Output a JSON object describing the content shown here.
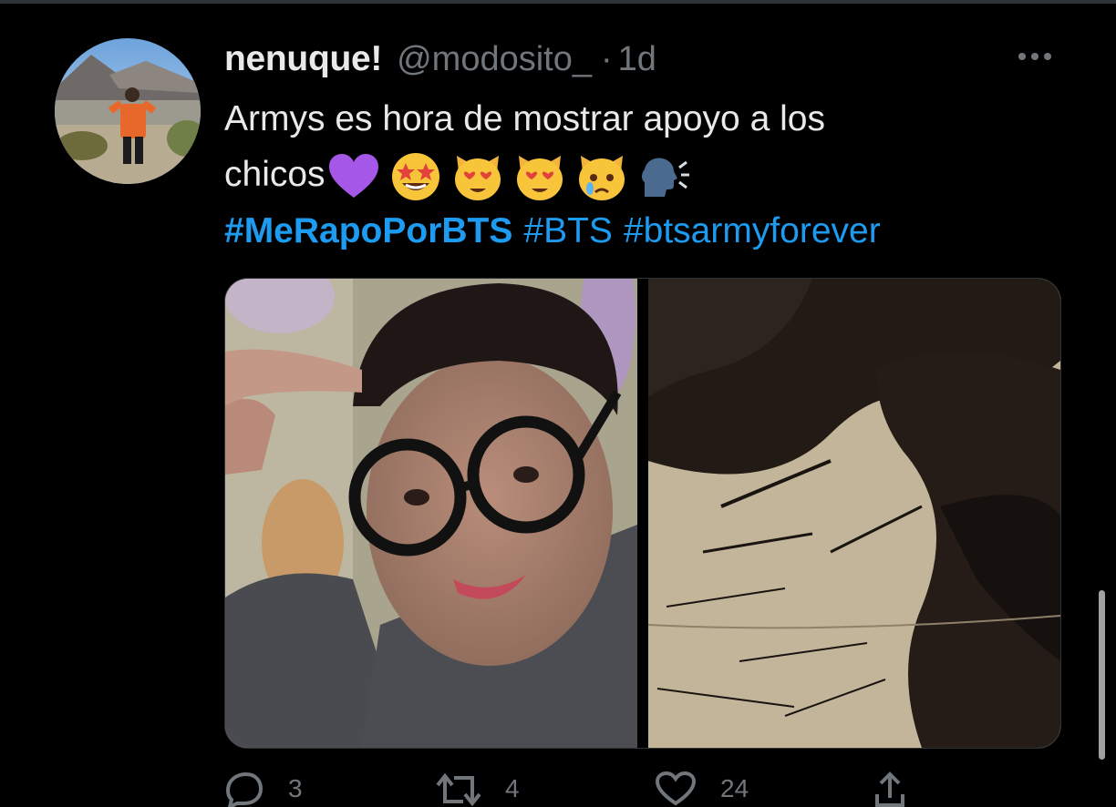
{
  "tweet": {
    "display_name": "nenuque!",
    "handle": "@modosito_",
    "separator": "·",
    "time": "1d",
    "text_line1": "Armys es hora de mostrar apoyo a los",
    "text_line2": "chicos",
    "emojis": [
      "purple-heart",
      "star-struck",
      "heart-eyes-cat",
      "heart-eyes-cat",
      "crying-cat",
      "speaking-head"
    ],
    "hashtags": [
      "#MeRapoPorBTS",
      "#BTS",
      "#btsarmyforever"
    ],
    "media": [
      "selfie-photo",
      "cut-hair-photo"
    ]
  },
  "actions": {
    "reply_count": "3",
    "retweet_count": "4",
    "like_count": "24"
  },
  "colors": {
    "background": "#000000",
    "text": "#e7e9ea",
    "muted": "#71767b",
    "link": "#1d9bf0"
  }
}
